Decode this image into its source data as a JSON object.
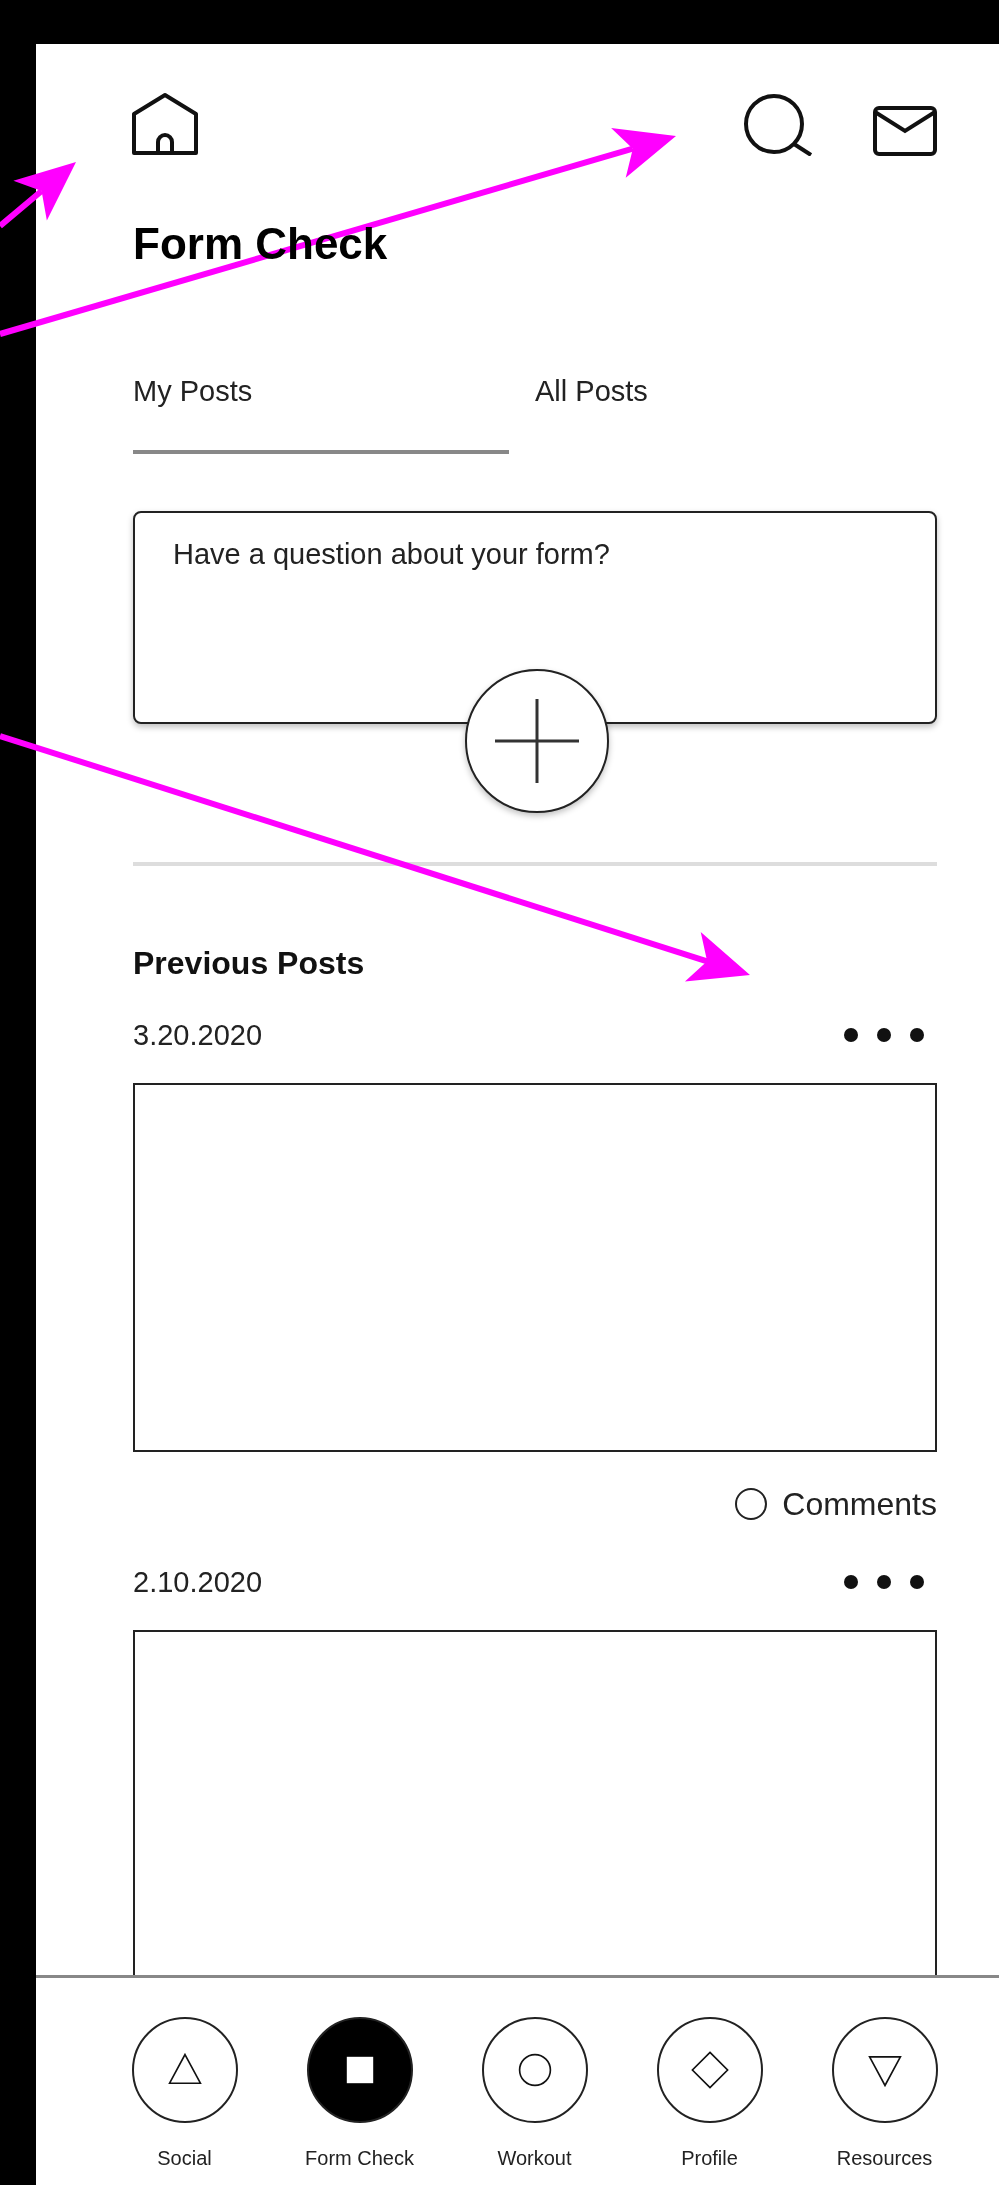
{
  "header": {
    "title": "Form Check"
  },
  "tabs": [
    {
      "label": "My Posts",
      "selected": true
    },
    {
      "label": "All Posts",
      "selected": false
    }
  ],
  "composer": {
    "placeholder": "Have a question about your form?"
  },
  "section_title": "Previous Posts",
  "posts": [
    {
      "date": "3.20.2020",
      "comments_label": "Comments"
    },
    {
      "date": "2.10.2020"
    }
  ],
  "bottom_nav": [
    {
      "label": "Social",
      "kind": "triangle",
      "selected": false
    },
    {
      "label": "Form Check",
      "kind": "square",
      "selected": true
    },
    {
      "label": "Workout",
      "kind": "circle",
      "selected": false
    },
    {
      "label": "Profile",
      "kind": "diamond",
      "selected": false
    },
    {
      "label": "Resources",
      "kind": "triangle-down",
      "selected": false
    }
  ]
}
